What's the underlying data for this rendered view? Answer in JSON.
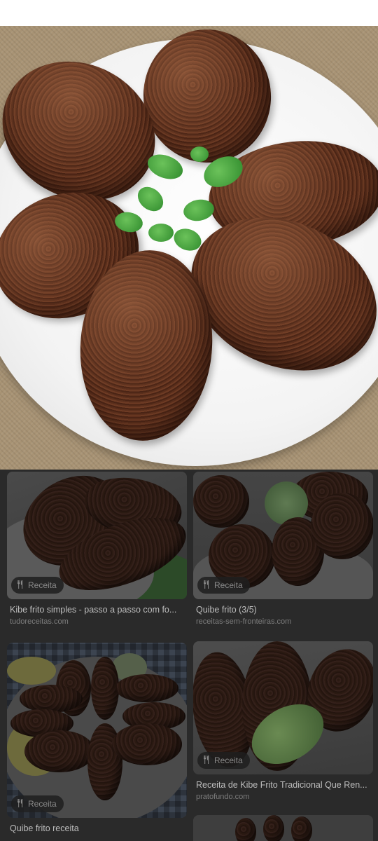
{
  "main_image": {
    "alt": "Kibe frito"
  },
  "results": [
    {
      "title": "Kibe frito simples - passo a passo com fo...",
      "source": "tudoreceitas.com",
      "badge": "Receita"
    },
    {
      "title": "Quibe frito (3/5)",
      "source": "receitas-sem-fronteiras.com",
      "badge": "Receita"
    },
    {
      "title": "Quibe frito receita",
      "source": "",
      "badge": "Receita"
    },
    {
      "title": "Receita de Kibe Frito Tradicional Que Ren...",
      "source": "pratofundo.com",
      "badge": "Receita"
    }
  ],
  "colors": {
    "background": "#2a2a2a",
    "title": "#bdbdbd",
    "source": "#7d7d7d",
    "badge_bg": "#1e1e1e"
  },
  "icons": {
    "badge": "restaurant-icon"
  }
}
